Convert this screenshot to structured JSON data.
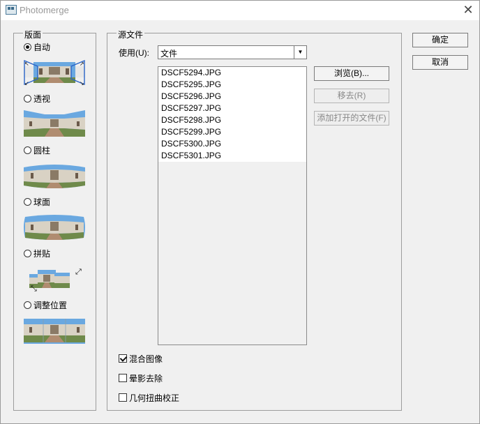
{
  "window": {
    "title": "Photomerge"
  },
  "layout_group": {
    "label": "版面",
    "options": [
      {
        "label": "自动",
        "selected": true,
        "icon": "auto-layout-preview"
      },
      {
        "label": "透视",
        "selected": false,
        "icon": "perspective-layout-preview"
      },
      {
        "label": "圆柱",
        "selected": false,
        "icon": "cylindrical-layout-preview"
      },
      {
        "label": "球面",
        "selected": false,
        "icon": "spherical-layout-preview"
      },
      {
        "label": "拼贴",
        "selected": false,
        "icon": "collage-layout-preview"
      },
      {
        "label": "调整位置",
        "selected": false,
        "icon": "reposition-layout-preview"
      }
    ]
  },
  "source_group": {
    "label": "源文件",
    "use_label": "使用(U):",
    "use_value": "文件",
    "files": [
      "DSCF5294.JPG",
      "DSCF5295.JPG",
      "DSCF5296.JPG",
      "DSCF5297.JPG",
      "DSCF5298.JPG",
      "DSCF5299.JPG",
      "DSCF5300.JPG",
      "DSCF5301.JPG"
    ],
    "browse_label": "浏览(B)...",
    "remove_label": "移去(R)",
    "add_open_label": "添加打开的文件(F)",
    "options": [
      {
        "label": "混合图像",
        "checked": true
      },
      {
        "label": "晕影去除",
        "checked": false
      },
      {
        "label": "几何扭曲校正",
        "checked": false
      }
    ]
  },
  "buttons": {
    "ok": "确定",
    "cancel": "取消"
  },
  "colors": {
    "sky": "#6aa8e0",
    "building": "#d9d2c4",
    "grass": "#6f8a4a",
    "path": "#b08c70",
    "handle": "#2a64c8"
  }
}
